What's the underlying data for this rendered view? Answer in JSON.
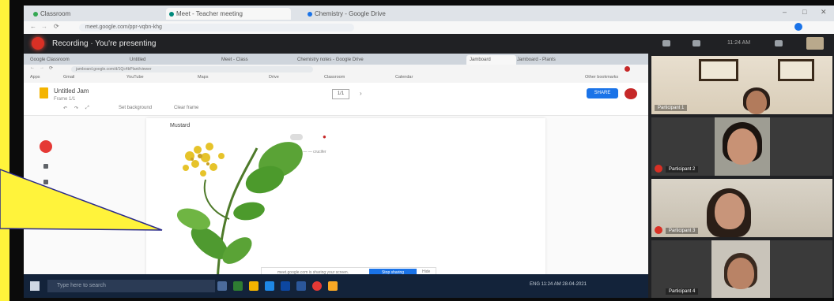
{
  "outer_browser": {
    "tabs": [
      "Classroom",
      "Meet - Teacher meeting",
      "Chemistry - Google Drive"
    ],
    "url": "meet.google.com/ppr-vqbn-khg",
    "window_controls": [
      "–",
      "□",
      "✕"
    ]
  },
  "meet": {
    "presenting_banner": "Recording · You're presenting",
    "clock": "11:24 AM"
  },
  "inner_browser": {
    "tabs": [
      "Google Classroom",
      "Untitled",
      "Meet - Class",
      "Chemistry notes - Google Drive",
      "Jamboard",
      "Jamboard - Plants"
    ],
    "url": "jamboard.google.com/d/1Qc4bPlant/viewer",
    "bookmarks": [
      "Apps",
      "Gmail",
      "YouTube",
      "Maps",
      "Drive",
      "Classroom",
      "Calendar",
      "Other bookmarks"
    ]
  },
  "app": {
    "name": "Untitled Jam",
    "menu": "Frame 1/1",
    "zoom": "1/1",
    "share_label": "SHARE",
    "toolbar": [
      "↶",
      "↷",
      "⤢",
      "Set background",
      "Clear frame"
    ]
  },
  "canvas": {
    "label": "Mustard",
    "note": "— — — crucifer"
  },
  "notification": {
    "text": "meet.google.com is sharing your screen.",
    "stop_label": "Stop sharing",
    "hide_label": "Hide"
  },
  "taskbar": {
    "search_placeholder": "Type here to search",
    "tray": "ENG  11:24 AM  28-04-2021"
  },
  "participants": [
    {
      "name": "Participant 1"
    },
    {
      "name": "Participant 2"
    },
    {
      "name": "Participant 3"
    },
    {
      "name": "Participant 4"
    }
  ],
  "colors": {
    "frame_yellow": "#fff33b",
    "meet_dark": "#202124",
    "accent_blue": "#1a73e8",
    "record_red": "#d93025"
  }
}
